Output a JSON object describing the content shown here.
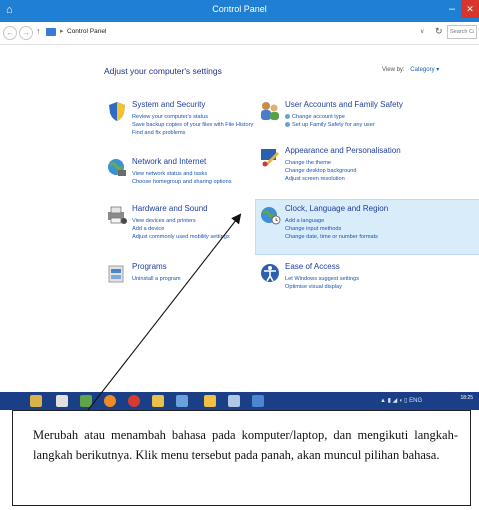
{
  "window": {
    "title": "Control Panel",
    "minimize_glyph": "–",
    "close_glyph": "✕"
  },
  "address": {
    "breadcrumb": "Control Panel",
    "search_placeholder": "Search Control Panel"
  },
  "content": {
    "heading": "Adjust your computer's settings",
    "view_by_label": "View by:",
    "view_by_value": "Category ▾"
  },
  "categories": [
    {
      "id": "system-security",
      "title": "System and Security",
      "links": [
        "Review your computer's status",
        "Save backup copies of your files with File History",
        "Find and fix problems"
      ],
      "icon": "shield-icon"
    },
    {
      "id": "network-internet",
      "title": "Network and Internet",
      "links": [
        "View network status and tasks",
        "Choose homegroup and sharing options"
      ],
      "icon": "globe-network-icon"
    },
    {
      "id": "hardware-sound",
      "title": "Hardware and Sound",
      "links": [
        "View devices and printers",
        "Add a device",
        "Adjust commonly used mobility settings"
      ],
      "icon": "printer-icon"
    },
    {
      "id": "programs",
      "title": "Programs",
      "links": [
        "Uninstall a program"
      ],
      "icon": "programs-icon"
    },
    {
      "id": "user-accounts",
      "title": "User Accounts and Family Safety",
      "links": [
        "Change account type",
        "Set up Family Safety for any user"
      ],
      "icon": "users-icon"
    },
    {
      "id": "appearance",
      "title": "Appearance and Personalisation",
      "links": [
        "Change the theme",
        "Change desktop background",
        "Adjust screen resolution"
      ],
      "icon": "appearance-icon"
    },
    {
      "id": "clock-language",
      "title": "Clock, Language and Region",
      "links": [
        "Add a language",
        "Change input methods",
        "Change date, time or number formats"
      ],
      "icon": "clock-globe-icon"
    },
    {
      "id": "ease-access",
      "title": "Ease of Access",
      "links": [
        "Let Windows suggest settings",
        "Optimise visual display"
      ],
      "icon": "ease-of-access-icon"
    }
  ],
  "taskbar": {
    "tray_text": "ENG",
    "clock": "18:25"
  },
  "caption": "Merubah atau menambah bahasa pada komputer/laptop, dan mengikuti langkah-langkah berikutnya. Klik menu tersebut pada panah, akan muncul pilihan bahasa."
}
